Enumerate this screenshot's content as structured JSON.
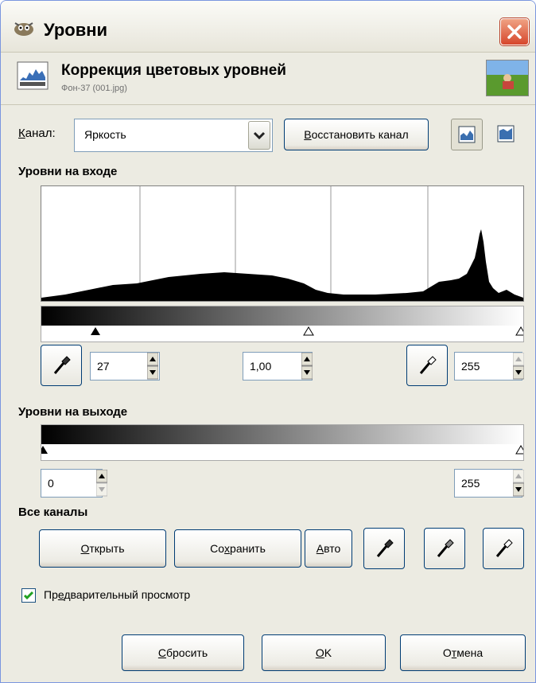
{
  "window": {
    "title": "Уровни",
    "close_icon": "close-icon"
  },
  "header": {
    "title": "Коррекция цветовых уровней",
    "subtitle": "Фон-37 (001.jpg)"
  },
  "channel": {
    "label_prefix": "К",
    "label_rest": "анал:",
    "selected": "Яркость",
    "reset_button": {
      "u": "В",
      "rest": "осстановить канал"
    }
  },
  "input_levels": {
    "title": "Уровни на входе",
    "low": "27",
    "gamma": "1,00",
    "high": "255"
  },
  "output_levels": {
    "title": "Уровни на выходе",
    "low": "0",
    "high": "255"
  },
  "all_channels": {
    "title": "Все каналы",
    "open": {
      "u": "О",
      "rest": "ткрыть"
    },
    "save": {
      "pre": "Со",
      "u": "х",
      "rest": "ранить"
    },
    "auto": {
      "u": "А",
      "rest": "вто"
    }
  },
  "preview": {
    "pre": "Пр",
    "u": "е",
    "rest": "дварительный просмотр",
    "checked": true
  },
  "footer": {
    "reset": {
      "u": "С",
      "rest": "бросить"
    },
    "ok": {
      "u": "О",
      "rest": "K"
    },
    "cancel": {
      "pre": "О",
      "u": "т",
      "rest": "мена"
    }
  },
  "colors": {
    "accent": "#003c74",
    "close": "#d6462c",
    "check": "#21a121"
  }
}
